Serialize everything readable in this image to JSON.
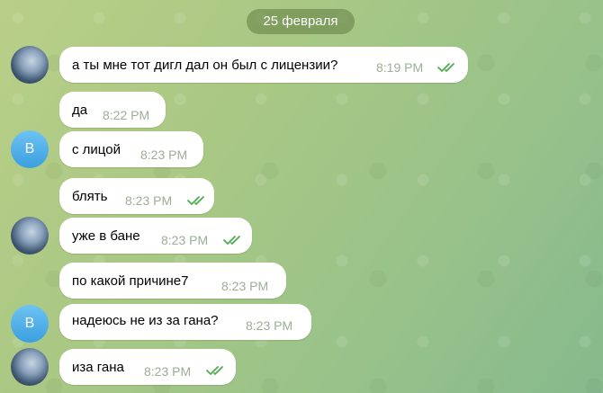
{
  "date_label": "25 февраля",
  "avatar_initial": "B",
  "messages": [
    {
      "text": "а ты мне тот дигл дал он был с лицензии?",
      "time": "8:19 PM"
    },
    {
      "text": "да",
      "time": "8:22 PM"
    },
    {
      "text": "с лицой",
      "time": "8:23 PM"
    },
    {
      "text": "блять",
      "time": "8:23 PM"
    },
    {
      "text": "уже в бане",
      "time": "8:23 PM"
    },
    {
      "text": "по какой причине7",
      "time": "8:23 PM"
    },
    {
      "text": "надеюсь не из за гана?",
      "time": "8:23 PM"
    },
    {
      "text": "иза гана",
      "time": "8:23 PM"
    }
  ],
  "colors": {
    "read_ticks": "#4fae4e",
    "bubble": "#ffffff",
    "date_pill": "#607c42"
  }
}
